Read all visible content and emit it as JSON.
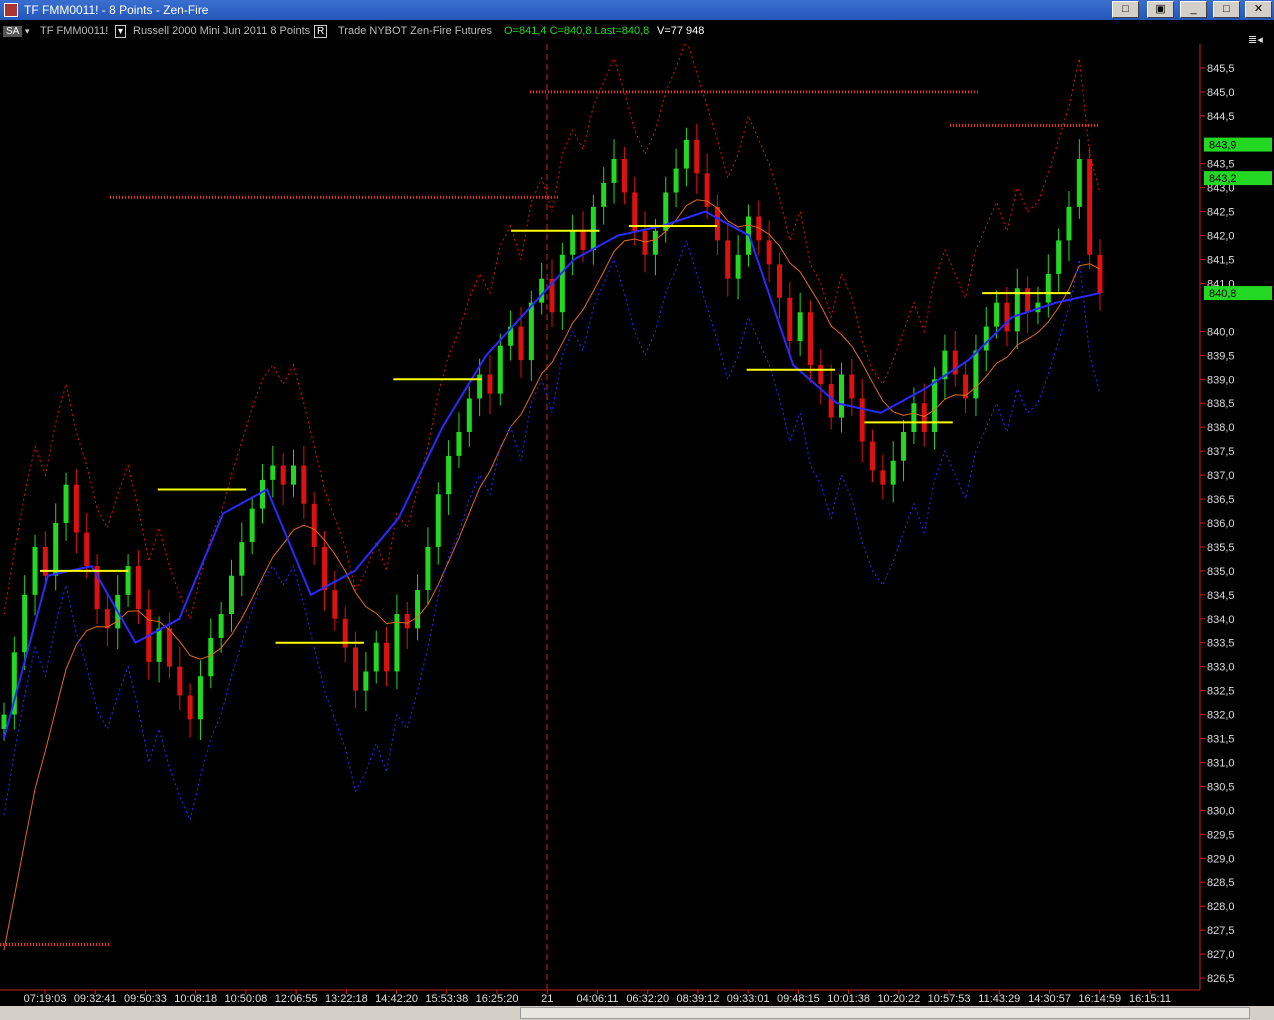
{
  "window": {
    "title": "TF  FMM0011! - 8 Points - Zen-Fire"
  },
  "infobar": {
    "sa_label": "SA",
    "symbol": "TF  FMM0011!",
    "instrument": "Russell 2000 Mini Jun 2011  8 Points",
    "r_label": "R",
    "mode": "Trade  NYBOT  Zen-Fire  Futures",
    "ohlc": "O=841,4  C=840,8  Last=840,8",
    "volume": "V=77 948",
    "panel_icon": "≣◂"
  },
  "colors": {
    "background": "#000000",
    "up_bar": "#22d822",
    "down_bar": "#dd1111",
    "blue_line": "#2a2aff",
    "yellow_line": "#ffff00",
    "orange_line": "#e06a1a",
    "resistance_dots": "#ff2a2a"
  },
  "chart_data": {
    "type": "candlestick",
    "y_axis": {
      "min": 826.25,
      "max": 846.0,
      "ticks": [
        "845,5",
        "845,0",
        "844,5",
        "843,5",
        "843,0",
        "842,5",
        "842,0",
        "841,5",
        "841,0",
        "840,0",
        "839,5",
        "839,0",
        "838,5",
        "838,0",
        "837,5",
        "837,0",
        "836,5",
        "836,0",
        "835,5",
        "835,0",
        "834,5",
        "834,0",
        "833,5",
        "833,0",
        "832,5",
        "832,0",
        "831,5",
        "831,0",
        "830,5",
        "830,0",
        "829,5",
        "829,0",
        "828,5",
        "828,0",
        "827,5",
        "827,0",
        "826,5"
      ],
      "tick_values": [
        845.5,
        845.0,
        844.5,
        843.5,
        843.0,
        842.5,
        842.0,
        841.5,
        841.0,
        840.0,
        839.5,
        839.0,
        838.5,
        838.0,
        837.5,
        837.0,
        836.5,
        836.0,
        835.5,
        835.0,
        834.5,
        834.0,
        833.5,
        833.0,
        832.5,
        832.0,
        831.5,
        831.0,
        830.5,
        830.0,
        829.5,
        829.0,
        828.5,
        828.0,
        827.5,
        827.0,
        826.5
      ]
    },
    "price_labels": [
      {
        "text": "843,9",
        "value": 843.9
      },
      {
        "text": "843,2",
        "value": 843.2
      },
      {
        "text": "840,8",
        "value": 840.8
      }
    ],
    "x_axis": {
      "labels": [
        "07:19:03",
        "09:32:41",
        "09:50:33",
        "10:08:18",
        "10:50:08",
        "12:06:55",
        "13:22:18",
        "14:42:20",
        "15:53:38",
        "16:25:20",
        "21",
        "04:06:11",
        "06:32:20",
        "08:39:12",
        "09:33:01",
        "09:48:15",
        "10:01:38",
        "10:20:22",
        "10:57:53",
        "11:43:29",
        "14:30:57",
        "16:14:59",
        "16:15:11"
      ]
    },
    "session_separator_label": "21",
    "closes": [
      832.0,
      833.3,
      834.5,
      835.5,
      834.9,
      836.0,
      836.8,
      835.8,
      835.1,
      834.2,
      833.8,
      834.5,
      835.1,
      834.2,
      833.1,
      833.8,
      833.0,
      832.4,
      831.9,
      832.8,
      833.6,
      834.1,
      834.9,
      835.6,
      836.3,
      836.9,
      837.2,
      836.8,
      837.2,
      836.4,
      835.5,
      834.6,
      834.0,
      833.4,
      832.5,
      832.9,
      833.5,
      832.9,
      834.1,
      833.8,
      834.6,
      835.5,
      836.6,
      837.4,
      837.9,
      838.6,
      839.1,
      838.7,
      839.7,
      840.1,
      839.4,
      840.6,
      841.1,
      840.4,
      841.6,
      842.1,
      841.7,
      842.6,
      843.1,
      843.6,
      842.9,
      842.1,
      841.6,
      842.1,
      842.9,
      843.4,
      844.0,
      843.3,
      842.6,
      841.9,
      841.1,
      841.6,
      842.4,
      841.9,
      841.4,
      840.7,
      839.8,
      840.4,
      839.3,
      838.9,
      838.2,
      839.1,
      838.6,
      837.7,
      837.1,
      836.8,
      837.3,
      837.9,
      838.5,
      837.9,
      839.0,
      839.6,
      839.1,
      838.6,
      839.6,
      840.1,
      840.6,
      840.0,
      840.9,
      840.4,
      840.6,
      841.2,
      841.9,
      842.6,
      843.6,
      841.6,
      840.8
    ],
    "blue_line": [
      831.5,
      834.9,
      835.1,
      833.5,
      834.0,
      836.2,
      836.7,
      834.5,
      835.0,
      836.1,
      838.0,
      839.5,
      840.5,
      841.5,
      842.0,
      842.2,
      842.5,
      842.0,
      839.3,
      838.5,
      838.3,
      838.8,
      839.4,
      840.3,
      840.6,
      840.8
    ],
    "yellow_segments": [
      {
        "from": 835.0,
        "to": 835.0
      },
      {
        "from": 836.7,
        "to": 836.7
      },
      {
        "from": 833.5,
        "to": 833.5
      },
      {
        "from": 839.0,
        "to": 839.0
      },
      {
        "from": 842.1,
        "to": 842.1
      },
      {
        "from": 842.2,
        "to": 842.2
      },
      {
        "from": 839.2,
        "to": 839.2
      },
      {
        "from": 838.1,
        "to": 838.1
      },
      {
        "from": 840.8,
        "to": 840.8
      }
    ],
    "resistance_levels": [
      827.2,
      842.8,
      845.0,
      844.3
    ]
  }
}
